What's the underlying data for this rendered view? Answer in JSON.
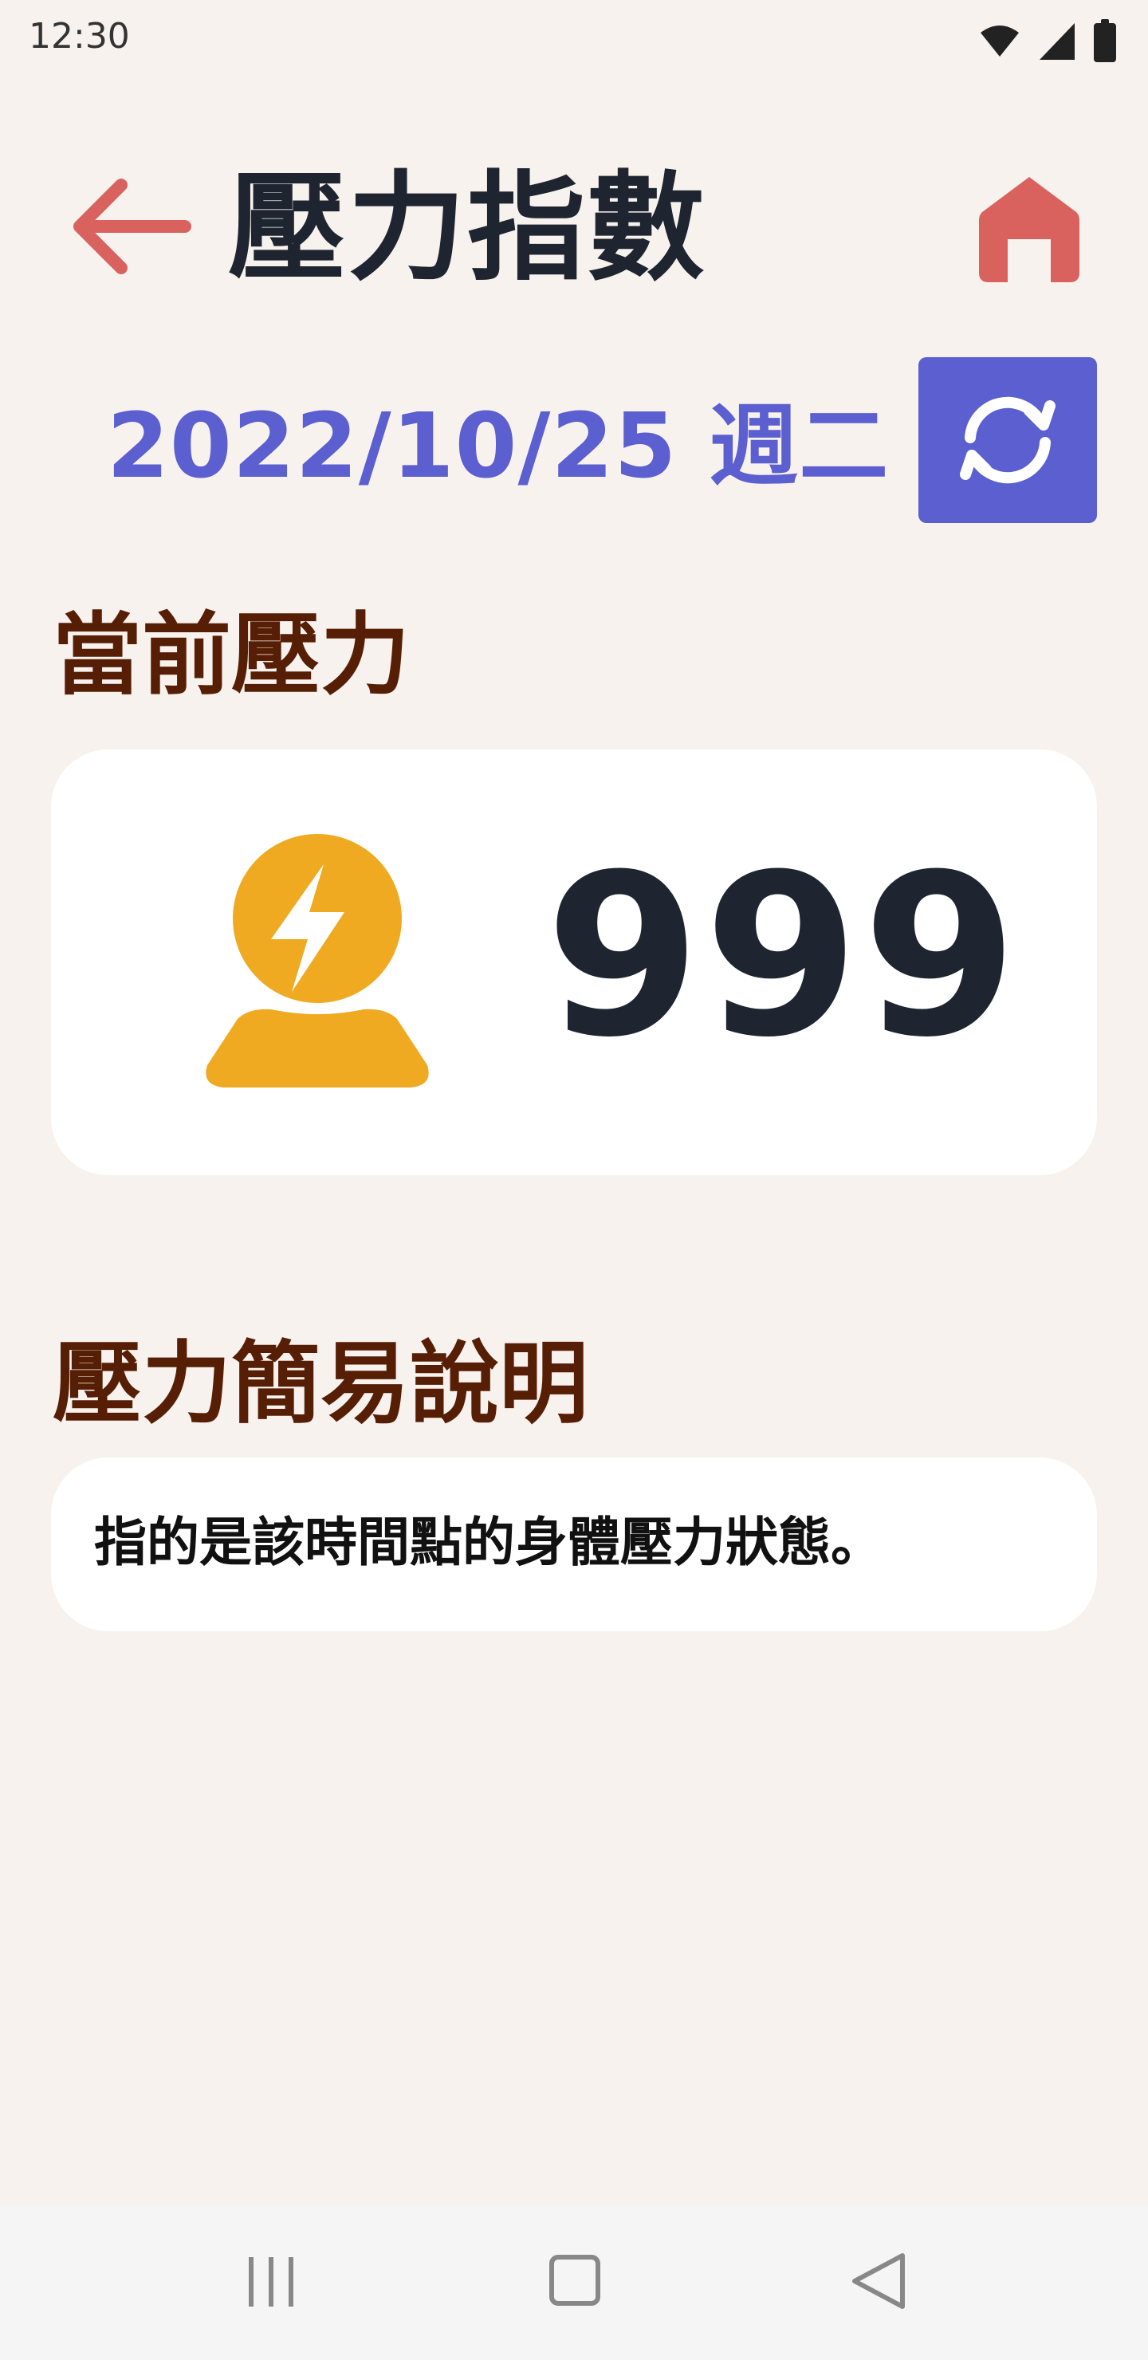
{
  "status_bar": {
    "time": "12:30",
    "icons": [
      "wifi-icon",
      "signal-icon",
      "battery-icon"
    ]
  },
  "header": {
    "title": "壓力指數",
    "back_icon": "arrow-left-icon",
    "home_icon": "home-icon"
  },
  "date": {
    "text": "2022/10/25 週二",
    "refresh_icon": "refresh-icon"
  },
  "current_stress": {
    "section_title": "當前壓力",
    "icon": "stress-person-icon",
    "value": "999"
  },
  "description": {
    "section_title": "壓力簡易說明",
    "text": "指的是該時間點的身體壓力狀態。"
  },
  "nav": {
    "icons": [
      "recent-apps-icon",
      "home-nav-icon",
      "back-nav-icon"
    ]
  },
  "colors": {
    "background": "#f8f2ee",
    "accent_red": "#d9625f",
    "accent_blue": "#5b5fcf",
    "section_brown": "#561f05",
    "stress_yellow": "#efaa22",
    "text_dark": "#1f2530"
  }
}
